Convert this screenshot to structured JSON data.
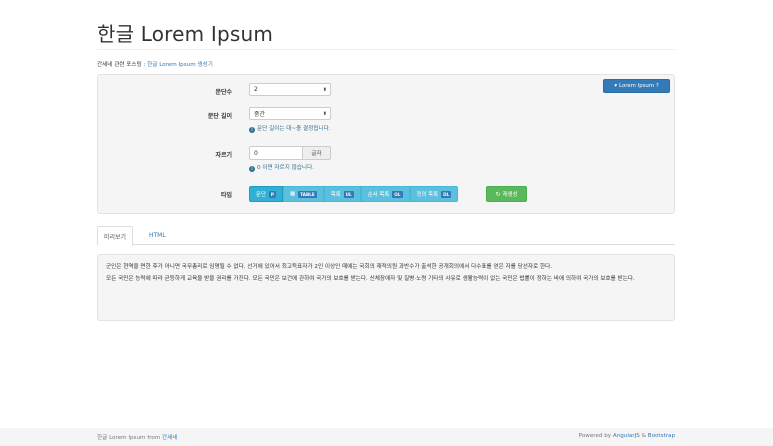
{
  "header": {
    "title": "한글 Lorem Ipsum"
  },
  "related": {
    "prefix": "간세네 관련 포스팅 : ",
    "link_text": "한글 Lorem Ipsum 생성기"
  },
  "toggle": {
    "label": "Lorem Ipsum ?",
    "caret": "▾"
  },
  "form": {
    "paragraph_count": {
      "label": "문단수",
      "value": "2"
    },
    "paragraph_length": {
      "label": "문단 길이",
      "value": "중간",
      "help": "문단 길이는 대~충 결정됩니다."
    },
    "cut": {
      "label": "자르기",
      "value": "0",
      "addon": "글자",
      "help": "0 이면 자르지 않습니다."
    },
    "type": {
      "label": "타입",
      "buttons": [
        {
          "text": "문단",
          "tag": "P",
          "icon": ""
        },
        {
          "text": "",
          "tag": "TABLE",
          "icon": "▦"
        },
        {
          "text": "목록",
          "tag": "UL",
          "icon": ""
        },
        {
          "text": "순서 목록",
          "tag": "OL",
          "icon": ""
        },
        {
          "text": "정의 목록",
          "tag": "DL",
          "icon": ""
        }
      ]
    },
    "regenerate": {
      "label": "재생성",
      "icon": "↻"
    }
  },
  "tabs": [
    {
      "label": "미리보기"
    },
    {
      "label": "HTML"
    }
  ],
  "preview": {
    "paragraphs": [
      "군인은 현역을 면한 후가 아니면 국무총리로 임명될 수 없다. 선거에 있어서 최고득표자가 2인 이상인 때에는 국회의 재적의원 과반수가 출석한 공개회의에서 다수표를 얻은 자를 당선자로 한다.",
      "모든 국민은 능력에 따라 균등하게 교육을 받을 권리를 가진다. 모든 국민은 보건에 관하여 국가의 보호를 받는다. 신체장애자 및 질병·노령 기타의 사유로 생활능력이 없는 국민은 법률이 정하는 바에 의하여 국가의 보호를 받는다."
    ]
  },
  "footer": {
    "left_prefix": "한글 Lorem Ipsum from ",
    "left_link": "간세네",
    "right_prefix": "Powered by ",
    "right_link1": "AngularJS",
    "right_amp": " & ",
    "right_link2": "Bootstrap"
  },
  "colors": {
    "primary": "#337ab7",
    "info": "#5bc0de",
    "success": "#5cb85c",
    "help": "#31708f"
  }
}
